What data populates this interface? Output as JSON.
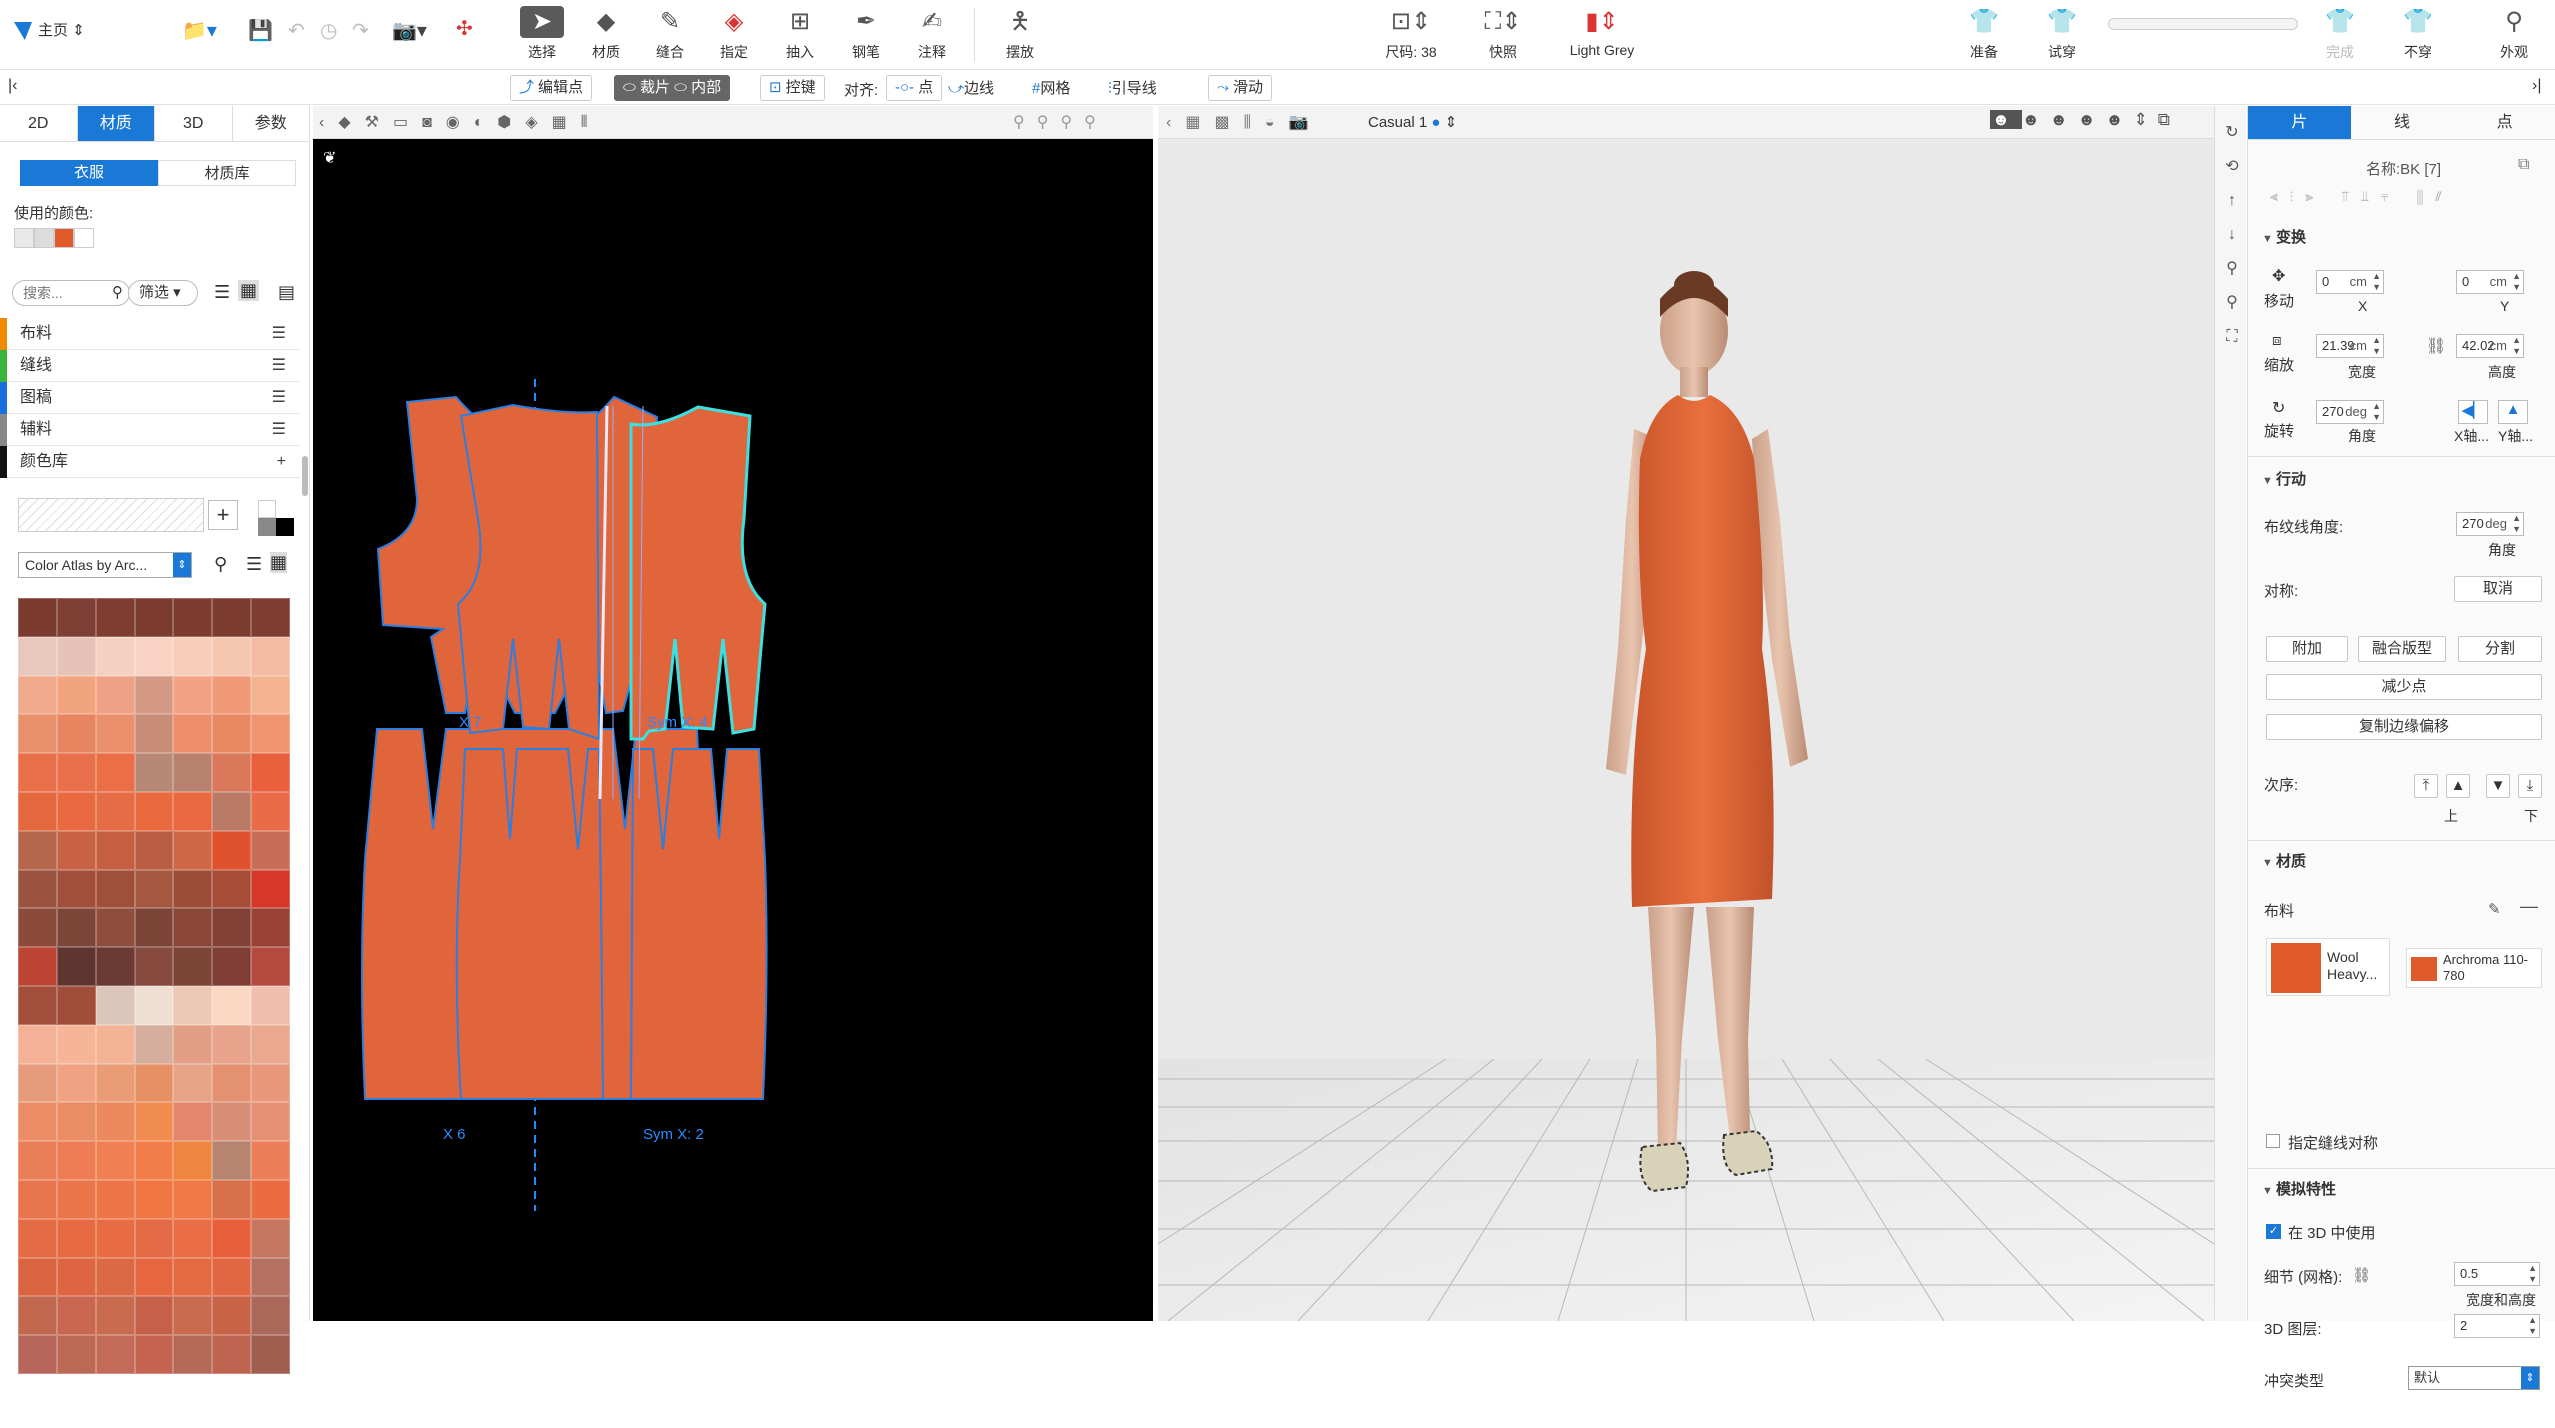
{
  "app": {
    "home_label": "主页"
  },
  "toolbar": {
    "select": "选择",
    "material": "材质",
    "sew": "缝合",
    "assign": "指定",
    "insert": "抽入",
    "pen": "钢笔",
    "annotate": "注释",
    "arrange": "摆放",
    "size": "尺码: 38",
    "snapshot": "快照",
    "avatar_color": "Light Grey",
    "prepare": "准备",
    "tryon": "试穿",
    "finish": "完成",
    "not_wear": "不穿",
    "appearance": "外观"
  },
  "toolbar2": {
    "edit_points": "编辑点",
    "pattern": "裁片",
    "internal": "内部",
    "control": "控键",
    "align": "对齐:",
    "point": "点",
    "edge": "边线",
    "grid": "网格",
    "guide": "引导线",
    "slide": "滑动"
  },
  "left_panel": {
    "tabs": [
      "2D",
      "材质",
      "3D",
      "参数"
    ],
    "subtabs": [
      "衣服",
      "材质库"
    ],
    "used_colors_label": "使用的颜色:",
    "used_colors": [
      "#e8e8e8",
      "#dcdcdc",
      "#e05a2c",
      "#ffffff"
    ],
    "search_placeholder": "搜索...",
    "filter_label": "筛选",
    "categories": [
      {
        "label": "布料",
        "color": "#f08a00"
      },
      {
        "label": "缝线",
        "color": "#3cb43c"
      },
      {
        "label": "图稿",
        "color": "#1a6fe0"
      },
      {
        "label": "辅料",
        "color": "#888888"
      },
      {
        "label": "颜色库",
        "color": "#111111"
      }
    ],
    "color_atlas": "Color Atlas by Arc...",
    "swatches": [
      "#7a3a2e",
      "#7d3f33",
      "#7e3d30",
      "#7b3b2f",
      "#7e3c31",
      "#7c3b2f",
      "#7f3d32",
      "#e8c7bd",
      "#e6c3b6",
      "#f3d0c2",
      "#f8d3c4",
      "#f6cdb9",
      "#f5c6b0",
      "#f4bba3",
      "#f0a98a",
      "#f2a47f",
      "#eea184",
      "#d59a86",
      "#f4a284",
      "#f09a78",
      "#f4b38f",
      "#e88f6c",
      "#e88561",
      "#ea906d",
      "#c88d78",
      "#ec8d6b",
      "#e98964",
      "#ee9470",
      "#e8714a",
      "#e8704a",
      "#ea6f47",
      "#b88876",
      "#b98270",
      "#d9785a",
      "#e9603d",
      "#e4683e",
      "#e96a40",
      "#e56d45",
      "#ea6a40",
      "#e8683f",
      "#b97a66",
      "#e96b47",
      "#b5664b",
      "#c96245",
      "#c65f42",
      "#b85c42",
      "#cf6747",
      "#e0512e",
      "#c86d57",
      "#9a533f",
      "#a14f3a",
      "#9f5038",
      "#a65841",
      "#9e4d38",
      "#a74c36",
      "#d5382b",
      "#8c4a3b",
      "#7e4639",
      "#8f4d3e",
      "#7c4337",
      "#8a4638",
      "#824036",
      "#9a4235",
      "#bb4433",
      "#5e3530",
      "#6b3a33",
      "#864a3e",
      "#7c4337",
      "#803e36",
      "#b54b3f",
      "#a14f3a",
      "#a04d3a",
      "#dcc6ba",
      "#efdfd3",
      "#ecc8b6",
      "#fbd8c3",
      "#f1bfae",
      "#f4b196",
      "#f7b598",
      "#f2b494",
      "#d6ae9d",
      "#e39f86",
      "#e7a48b",
      "#eaa88e",
      "#e69b7c",
      "#f0a283",
      "#ea9c76",
      "#e79065",
      "#e5a486",
      "#e49171",
      "#e8977a",
      "#eb8d64",
      "#e98d65",
      "#ec8a5d",
      "#f08c50",
      "#e2876c",
      "#d98e76",
      "#e69074",
      "#ea7f57",
      "#ee7d53",
      "#f07f52",
      "#f27e4c",
      "#f0853f",
      "#b7856f",
      "#ec7f58",
      "#e8764d",
      "#ea7549",
      "#ec7647",
      "#f07743",
      "#ee7846",
      "#d9704c",
      "#ec6c41",
      "#e36b44",
      "#e66b42",
      "#e86c41",
      "#e46b46",
      "#ea6e45",
      "#e85f3b",
      "#c77760",
      "#d8653f",
      "#dd6541",
      "#db6a44",
      "#e5663f",
      "#e36a41",
      "#e06741",
      "#b47161",
      "#c1684f",
      "#c96650",
      "#c96b4e",
      "#c56148",
      "#c86a4e",
      "#c96348",
      "#a9685a",
      "#b6665b",
      "#bc6955",
      "#c16b58",
      "#c4634f",
      "#b56a57",
      "#c06452",
      "#9f5f50"
    ]
  },
  "view2d": {
    "labels": {
      "x7": "X 7",
      "symx4": "Sym X: 4",
      "x6": "X 6",
      "symx2": "Sym X: 2"
    },
    "pattern_color": "#e0653a"
  },
  "view3d": {
    "casual": "Casual 1"
  },
  "props": {
    "tabs": [
      "片",
      "线",
      "点"
    ],
    "name": "名称:BK [7]",
    "sections": {
      "transform": "变换",
      "behavior": "行动",
      "material": "材质",
      "sim": "模拟特性"
    },
    "move_label": "移动",
    "move_x": "0",
    "move_y": "0",
    "unit_cm": "cm",
    "x": "X",
    "y": "Y",
    "scale_label": "缩放",
    "width": "21.39",
    "height": "42.02",
    "width_label": "宽度",
    "height_label": "高度",
    "rotate_label": "旋转",
    "rotate": "270",
    "unit_deg": "deg",
    "angle_label": "角度",
    "xaxis": "X轴...",
    "yaxis": "Y轴...",
    "grain_label": "布纹线角度:",
    "grain": "270",
    "sym_label": "对称:",
    "cancel": "取消",
    "attach": "附加",
    "merge": "融合版型",
    "split": "分割",
    "reduce_points": "减少点",
    "copy_offset": "复制边缘偏移",
    "order_label": "次序:",
    "up": "上",
    "down": "下",
    "fabric_label": "布料",
    "fabric_name": "Wool Heavy...",
    "color_name": "Archroma 110-780",
    "fabric_color": "#e05a2c",
    "assign_seam_sym": "指定缝线对称",
    "use_in_3d": "在 3D 中使用",
    "detail_label": "细节 (网格):",
    "detail": "0.5",
    "wh_label": "宽度和高度",
    "layer_label": "3D 图层:",
    "layer": "2",
    "collision_label": "冲突类型",
    "collision": "默认"
  }
}
